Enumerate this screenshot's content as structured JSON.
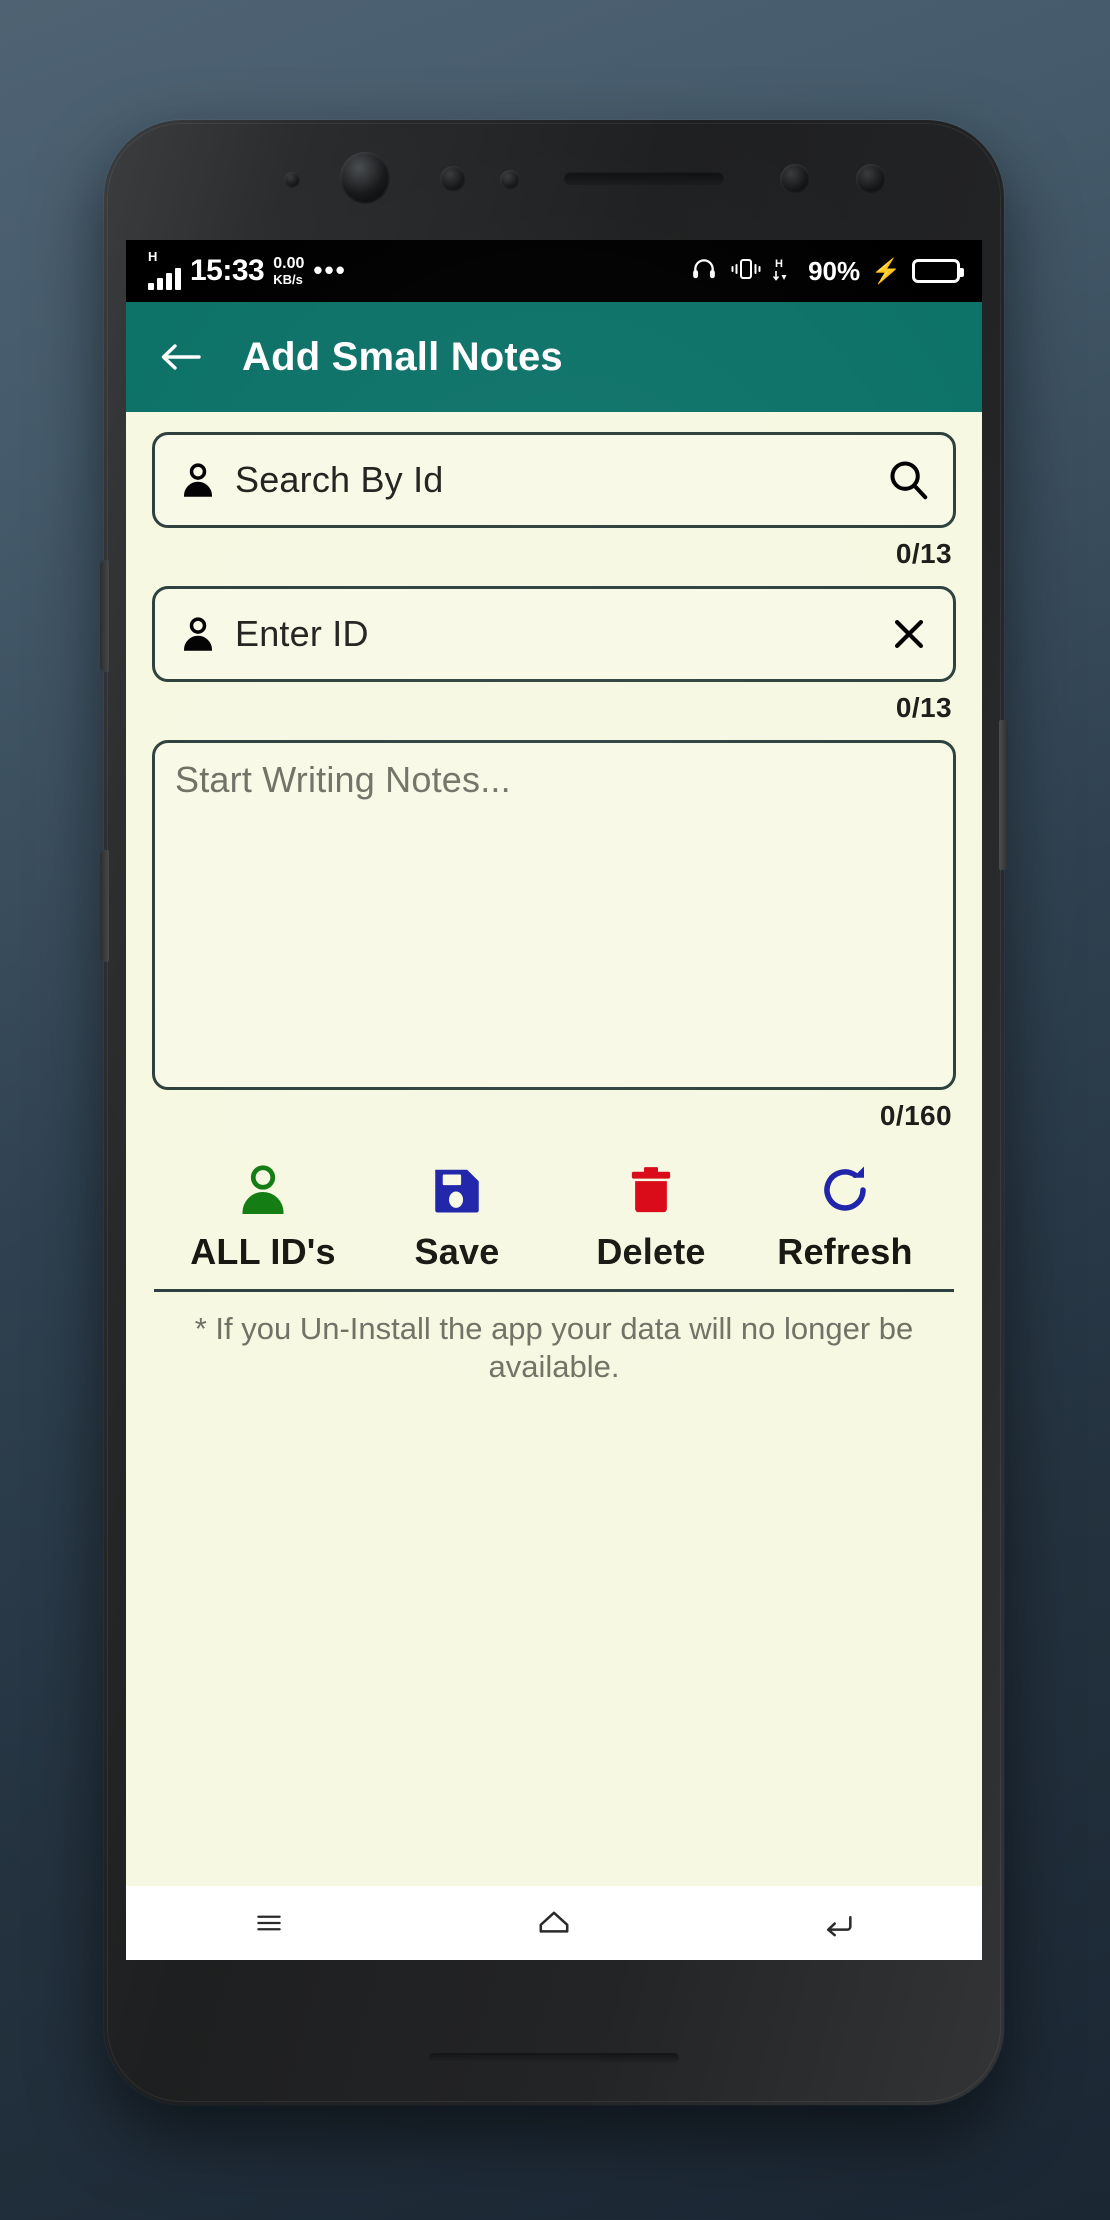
{
  "status_bar": {
    "network_type": "H",
    "time": "15:33",
    "data_rate_value": "0.00",
    "data_rate_unit": "KB/s",
    "overflow_dots": "•••",
    "icons": {
      "headphones": "headphones-icon",
      "vibrate": "vibrate-icon",
      "hsdpa": "H",
      "charging": "charging-bolt-icon",
      "battery": "battery-icon"
    },
    "battery_percent": "90%"
  },
  "app_bar": {
    "back_label": "back-arrow",
    "title": "Add Small Notes",
    "background_color": "#0d7268",
    "title_color": "#ffffff"
  },
  "search_field": {
    "leading_icon": "person-icon",
    "placeholder": "Search By Id",
    "value": "",
    "trailing_icon": "search-icon",
    "counter": "0/13"
  },
  "id_field": {
    "leading_icon": "person-icon",
    "placeholder": "Enter ID",
    "value": "",
    "trailing_icon": "close-icon",
    "counter": "0/13"
  },
  "notes_field": {
    "placeholder": "Start Writing Notes...",
    "value": "",
    "counter": "0/160"
  },
  "actions": [
    {
      "label": "ALL ID's",
      "icon": "person-icon",
      "color": "#107c10"
    },
    {
      "label": "Save",
      "icon": "floppy-disk-icon",
      "color": "#1c21a8"
    },
    {
      "label": "Delete",
      "icon": "trash-icon",
      "color": "#d90413"
    },
    {
      "label": "Refresh",
      "icon": "refresh-icon",
      "color": "#1c21a8"
    }
  ],
  "footnote": "* If you Un-Install the app your data will no longer be available.",
  "nav_bar": {
    "recents": "menu-icon",
    "home": "home-icon",
    "back": "back-icon"
  },
  "theme": {
    "page_background": "#f7f8e2",
    "field_border": "#2d403e",
    "accent": "#0d7268",
    "muted_text": "#6f7165"
  }
}
